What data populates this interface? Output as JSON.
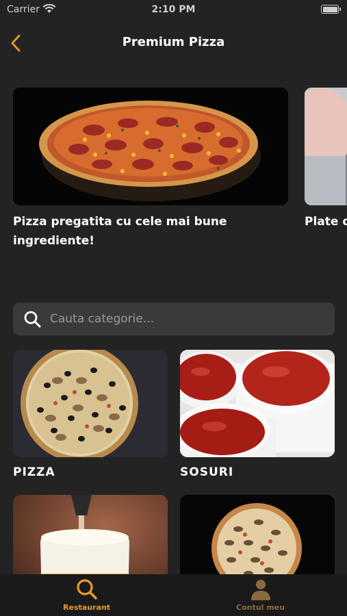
{
  "status_bar": {
    "carrier": "Carrier",
    "time": "2:10 PM"
  },
  "header": {
    "title": "Premium Pizza"
  },
  "carousel": {
    "slides": [
      {
        "caption": "Pizza pregatita cu cele mai bune ingrediente!"
      },
      {
        "caption": "Plate dire"
      }
    ]
  },
  "search": {
    "placeholder": "Cauta categorie...",
    "value": ""
  },
  "categories": [
    {
      "label": "PIZZA"
    },
    {
      "label": "SOSURI"
    },
    {
      "label": ""
    },
    {
      "label": ""
    }
  ],
  "tab_bar": {
    "items": [
      {
        "label": "Restaurant",
        "icon": "search-icon",
        "active": true
      },
      {
        "label": "Contul meu",
        "icon": "user-icon",
        "active": false
      }
    ]
  },
  "colors": {
    "accent": "#e89a2e",
    "background": "#232323",
    "tab_bar": "#1a1a1a",
    "inactive": "#8a6a3e"
  }
}
